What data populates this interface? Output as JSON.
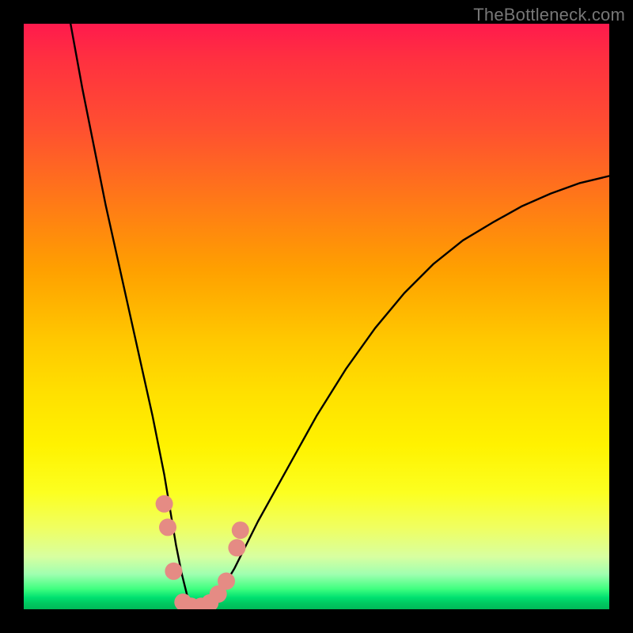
{
  "watermark": "TheBottleneck.com",
  "chart_data": {
    "type": "line",
    "title": "",
    "xlabel": "",
    "ylabel": "",
    "xlim": [
      0,
      100
    ],
    "ylim": [
      0,
      100
    ],
    "series": [
      {
        "name": "bottleneck-curve",
        "x": [
          8,
          10,
          12,
          14,
          16,
          18,
          20,
          22,
          24,
          25,
          26,
          27,
          28,
          29,
          30,
          31,
          33,
          36,
          40,
          45,
          50,
          55,
          60,
          65,
          70,
          75,
          80,
          85,
          90,
          95,
          100
        ],
        "y": [
          100,
          89,
          79,
          69,
          60,
          51,
          42,
          33,
          23,
          17,
          11,
          6,
          2,
          0,
          0,
          0,
          2,
          7,
          15,
          24,
          33,
          41,
          48,
          54,
          59,
          63,
          66,
          68.8,
          71,
          72.8,
          74
        ]
      }
    ],
    "markers": [
      {
        "x": 24.0,
        "y": 18.0
      },
      {
        "x": 24.6,
        "y": 14.0
      },
      {
        "x": 25.6,
        "y": 6.5
      },
      {
        "x": 27.2,
        "y": 1.2
      },
      {
        "x": 28.6,
        "y": 0.5
      },
      {
        "x": 30.3,
        "y": 0.5
      },
      {
        "x": 31.8,
        "y": 1.1
      },
      {
        "x": 33.2,
        "y": 2.6
      },
      {
        "x": 34.6,
        "y": 4.8
      },
      {
        "x": 36.4,
        "y": 10.5
      },
      {
        "x": 37.0,
        "y": 13.5
      }
    ],
    "colors": {
      "curve": "#000000",
      "markers": "#e58b84"
    }
  }
}
